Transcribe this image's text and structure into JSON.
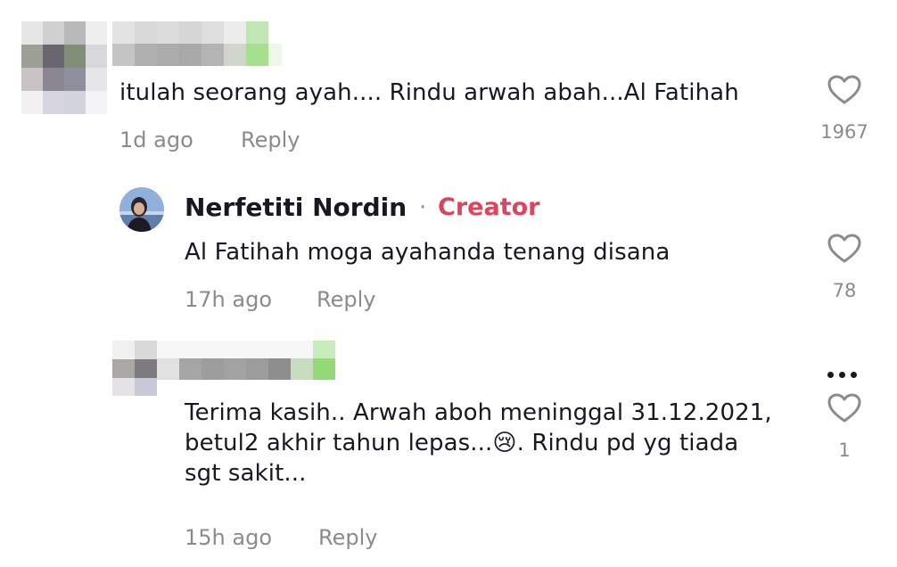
{
  "comments": [
    {
      "text": "itulah seorang ayah.... Rindu arwah abah...Al Fatihah",
      "time": "1d ago",
      "reply_label": "Reply",
      "likes": "1967"
    },
    {
      "username": "Nerfetiti Nordin",
      "separator": "·",
      "badge": "Creator",
      "text": "Al Fatihah moga ayahanda tenang disana",
      "time": "17h ago",
      "reply_label": "Reply",
      "likes": "78"
    },
    {
      "text_line1": "Terima kasih.. Arwah aboh meninggal 31.12.2021,",
      "text_line2a": "betul2 akhir tahun lepas...",
      "emoji": "😢",
      "text_line2b": ". Rindu pd yg tiada",
      "text_line3": "sgt sakit...",
      "time": "15h ago",
      "reply_label": "Reply",
      "likes": "1"
    }
  ],
  "icons": {
    "like": "heart-outline-icon",
    "more": "more-horizontal-icon"
  },
  "colors": {
    "text": "#161823",
    "secondary": "#8a8b91",
    "creator_badge": "#e0445c"
  }
}
